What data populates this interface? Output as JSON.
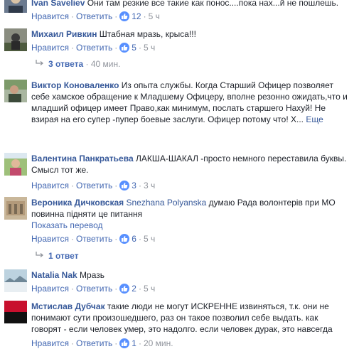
{
  "comments": [
    {
      "author": "Ivan Saveliev",
      "text": "Они там резкие все такие как понос....пока нах...й не пошлешь.",
      "like": "Нравится",
      "reply": "Ответить",
      "reactions": "12",
      "time": "5 ч"
    },
    {
      "author": "Михаил Ривкин",
      "text": "Штабная мразь, крыса!!!",
      "like": "Нравится",
      "reply": "Ответить",
      "reactions": "5",
      "time": "5 ч",
      "replies_label": "3 ответа",
      "replies_time": "40 мин."
    },
    {
      "author": "Виктор Коноваленко",
      "text": "Из опыта службы. Когда Старший Офицер позволяет себе хамское обращение к Младшему Офицеру, вполне резонно ожидать,что и младший офицер имеет Право,как минимум, послать старшего Нахуй! Не взирая на его супер -пупер боевые заслуги. Офицер потому что! Х...",
      "more": "Еще"
    },
    {
      "author": "Валентина Панкратьева",
      "text": "ЛАКША-ШАКАЛ -просто немного переставила буквы. Смысл тот же.",
      "like": "Нравится",
      "reply": "Ответить",
      "reactions": "3",
      "time": "3 ч"
    },
    {
      "author": "Вероника Дичковская",
      "tag": "Snezhana Polyanska",
      "text": "думаю Рада волонтерів при МО повинна підняти це питання",
      "translate": "Показать перевод",
      "like": "Нравится",
      "reply": "Ответить",
      "reactions": "6",
      "time": "5 ч",
      "replies_label": "1 ответ"
    },
    {
      "author": "Natalia Nak",
      "text": "Мразь",
      "like": "Нравится",
      "reply": "Ответить",
      "reactions": "2",
      "time": "5 ч"
    },
    {
      "author": "Мстислав Дубчак",
      "text": "такие люди не могут ИСКРЕННЕ извиняться, т.к. они не понимают сути произошедшего, раз он такое позволил себе выдать. как говорят - если человек умер, это надолго. если человек дурак, это навсегда",
      "like": "Нравится",
      "reply": "Ответить",
      "reactions": "1",
      "time": "20 мин."
    }
  ],
  "colors": {
    "link": "#365899",
    "action": "#4267b2",
    "meta": "#90949c",
    "like_badge": "#5890ff"
  },
  "icons": {
    "like": "thumbs-up-icon",
    "reply_arrow": "reply-arrow-icon"
  }
}
